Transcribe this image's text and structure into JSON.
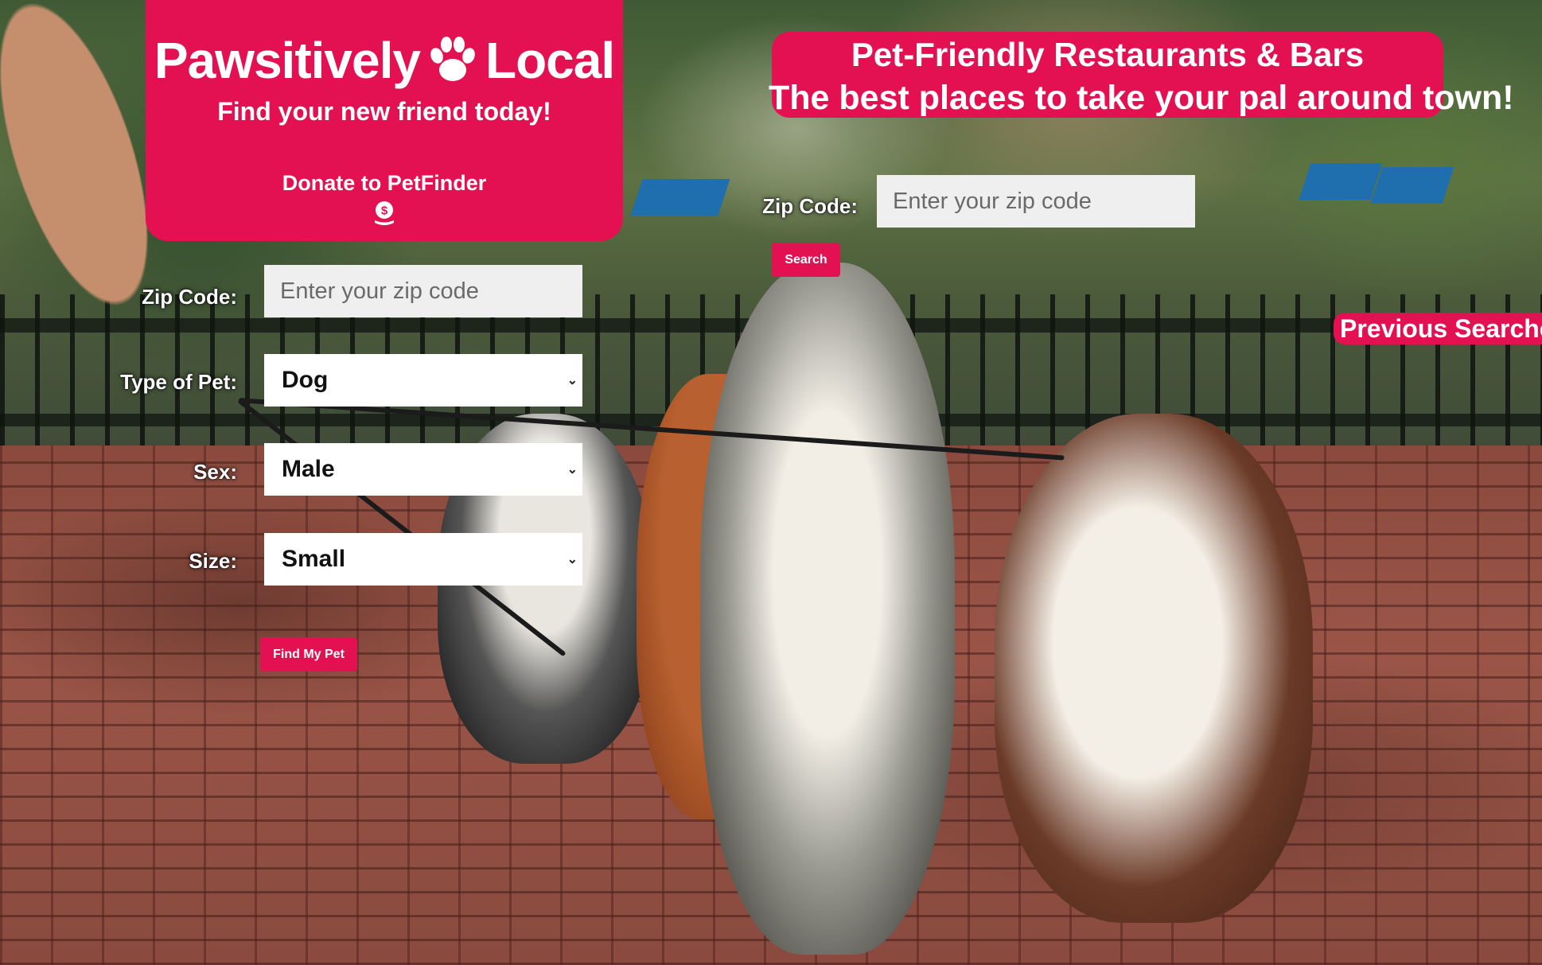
{
  "brand": {
    "title_left": "Pawsitively",
    "title_right": "Local",
    "subtitle": "Find your new friend today!",
    "donate_label": "Donate to PetFinder"
  },
  "pet_form": {
    "zip_label": "Zip Code:",
    "zip_placeholder": "Enter your zip code",
    "type_label": "Type of Pet:",
    "type_value": "Dog",
    "sex_label": "Sex:",
    "sex_value": "Male",
    "size_label": "Size:",
    "size_value": "Small",
    "submit_label": "Find My Pet"
  },
  "restaurants": {
    "heading_line1": "Pet-Friendly Restaurants & Bars",
    "heading_line2": "The best places to take your pal around town!",
    "zip_label": "Zip Code:",
    "zip_placeholder": "Enter your zip code",
    "search_label": "Search",
    "previous_searches_label": "Previous Searches:"
  },
  "icons": {
    "paw": "paw-icon",
    "donate": "money-bag-icon",
    "dropdown": "chevron-down-icon"
  },
  "colors": {
    "accent": "#e41152",
    "input_bg": "#efefef",
    "text_light": "#ffffff"
  }
}
